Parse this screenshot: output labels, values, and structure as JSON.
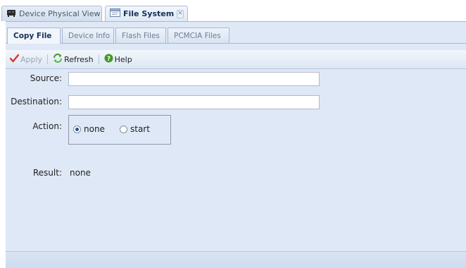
{
  "doc_tabs": [
    {
      "label": "Device Physical View",
      "icon": "device-icon",
      "active": false
    },
    {
      "label": "File System",
      "icon": "window-icon",
      "active": true,
      "close": "×"
    }
  ],
  "sub_tabs": [
    {
      "label": "Copy File",
      "active": true
    },
    {
      "label": "Device Info",
      "active": false
    },
    {
      "label": "Flash Files",
      "active": false
    },
    {
      "label": "PCMCIA Files",
      "active": false
    }
  ],
  "toolbar": {
    "apply_label": "Apply",
    "refresh_label": "Refresh",
    "help_label": "Help"
  },
  "form": {
    "source_label": "Source:",
    "source_value": "",
    "destination_label": "Destination:",
    "destination_value": "",
    "action_label": "Action:",
    "action_options": [
      {
        "label": "none",
        "selected": true
      },
      {
        "label": "start",
        "selected": false
      }
    ],
    "result_label": "Result:",
    "result_value": "none"
  },
  "colors": {
    "panel_bg": "#dfe8f6",
    "border": "#99bbe8",
    "apply_check": "#d9332b",
    "help_icon": "#3e9a1e"
  }
}
